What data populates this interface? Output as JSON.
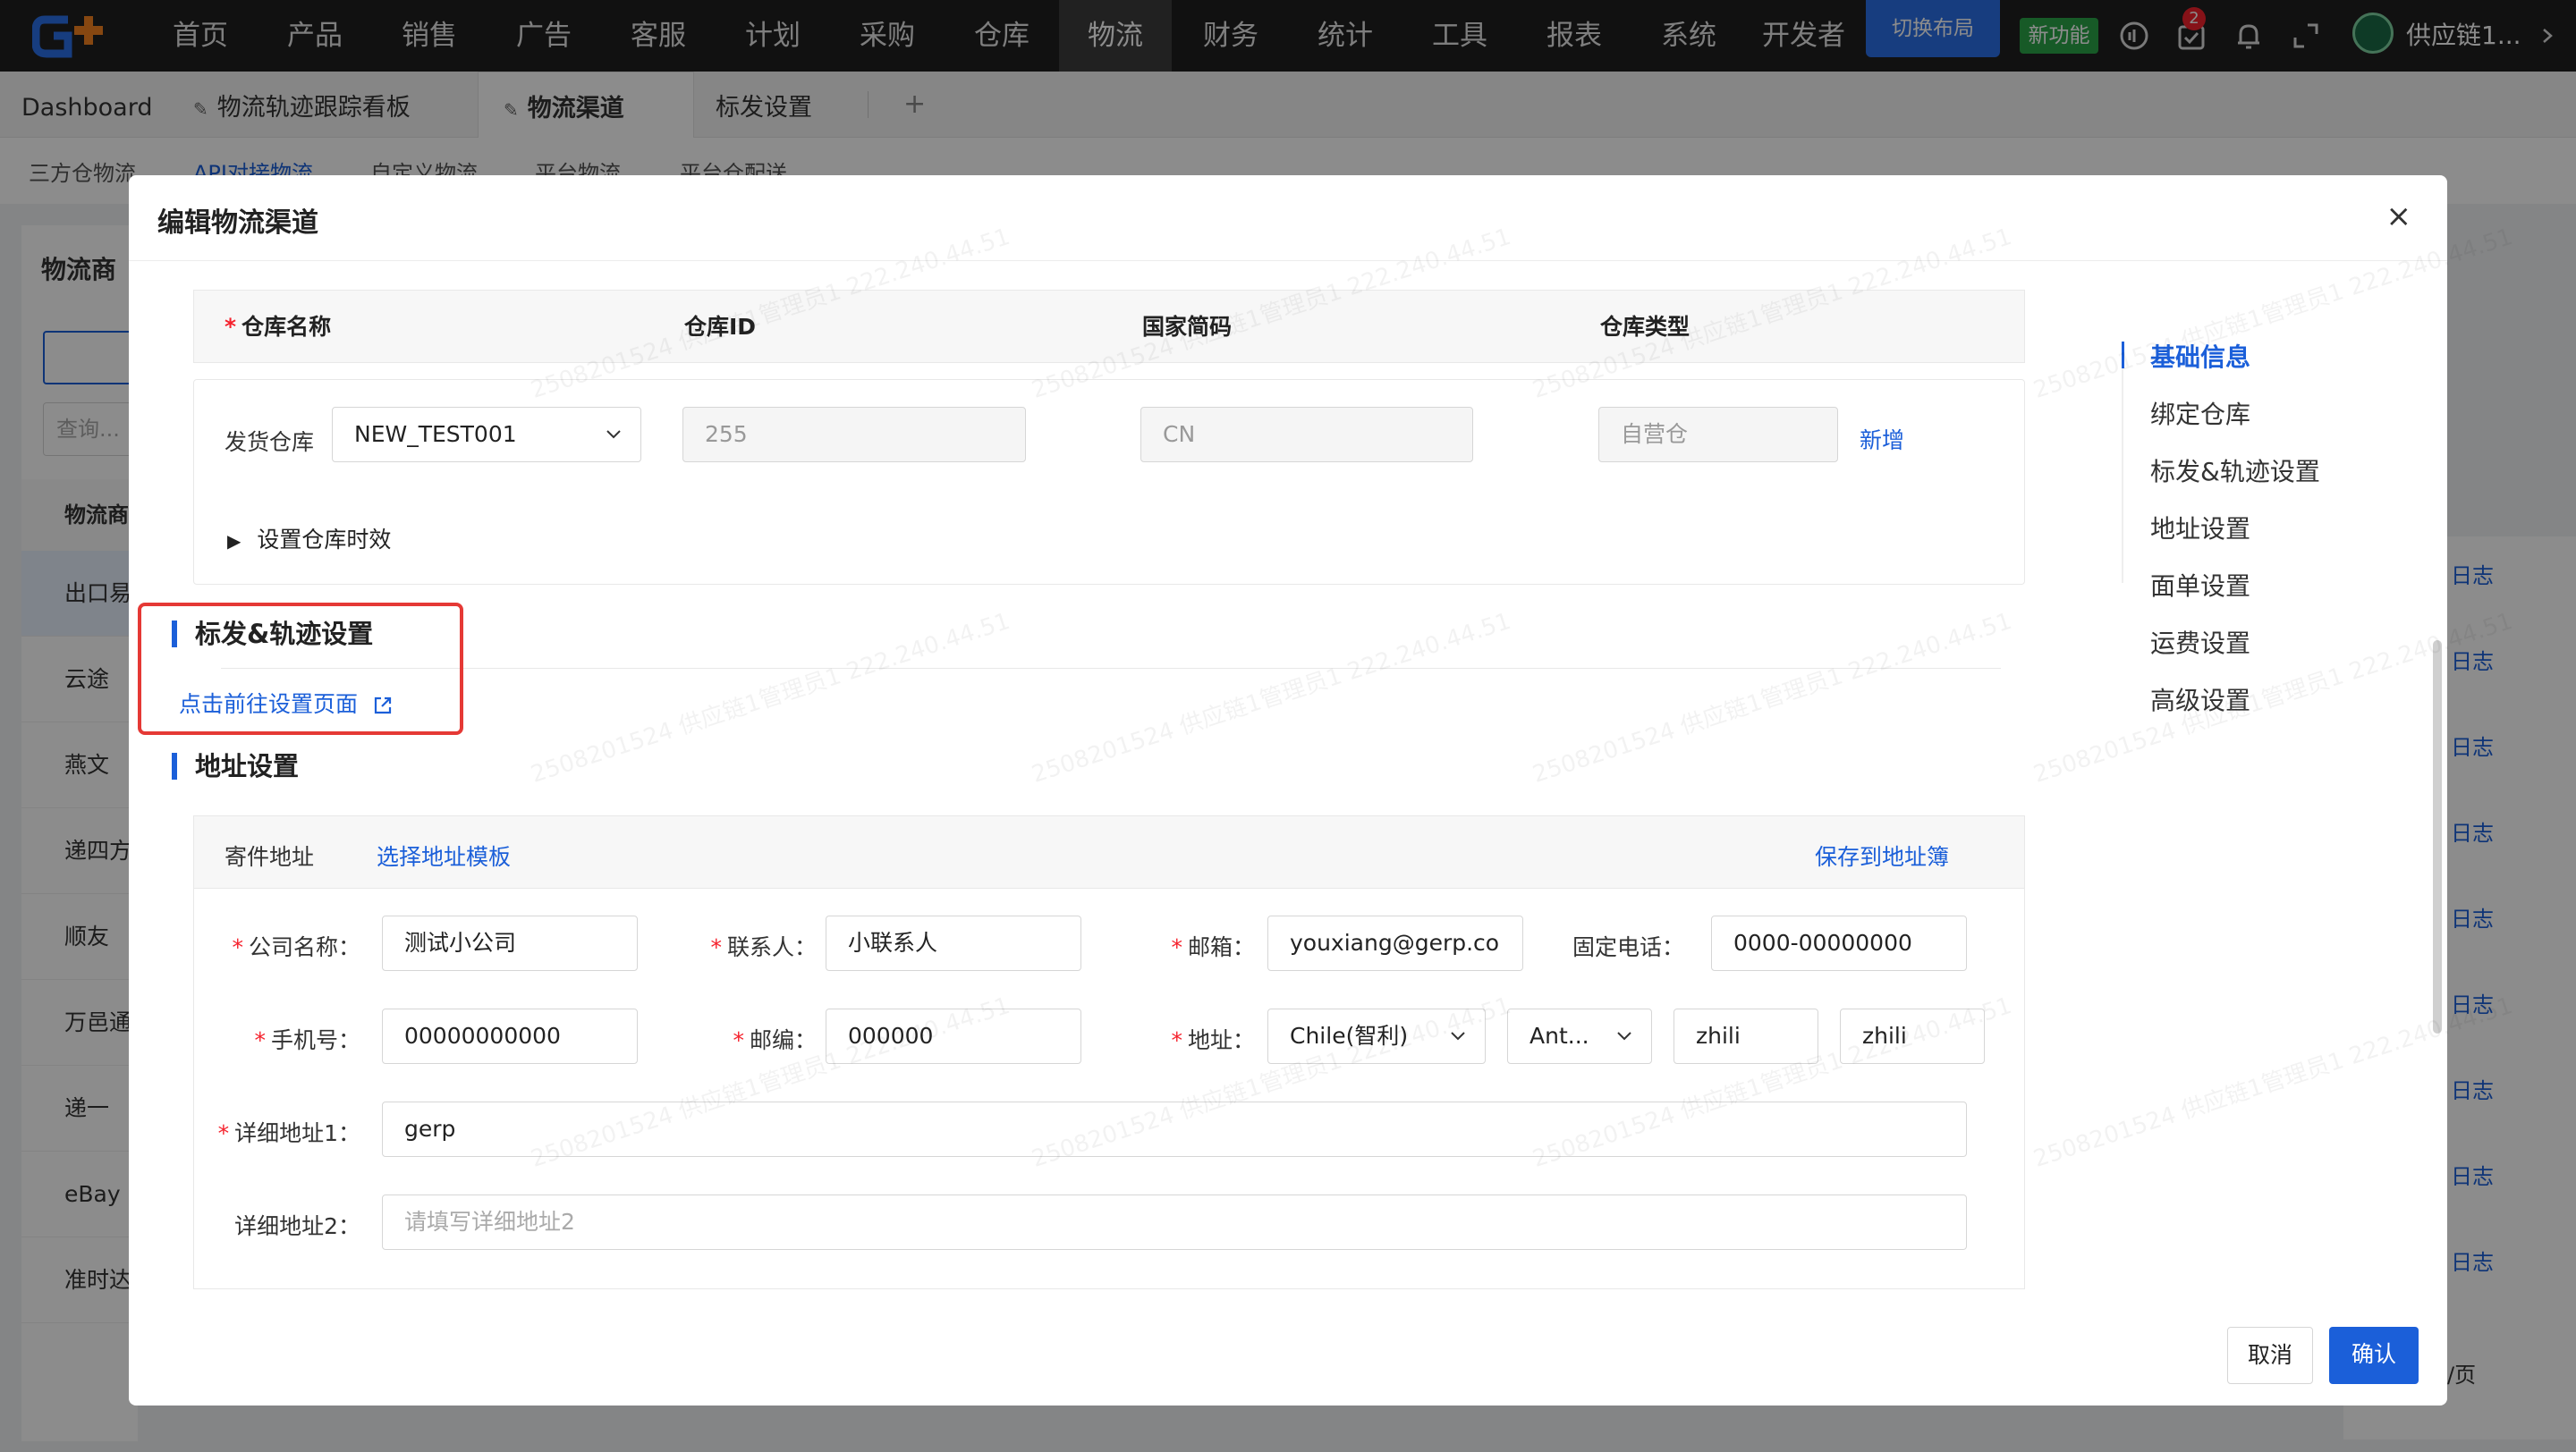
{
  "topnav": {
    "items": [
      "首页",
      "产品",
      "销售",
      "广告",
      "客服",
      "计划",
      "采购",
      "仓库",
      "物流",
      "财务",
      "统计",
      "工具",
      "报表",
      "系统",
      "开发者"
    ],
    "active": "物流",
    "switch_layout": "切换布局",
    "new_feature": "新功能",
    "notification_count": "2",
    "user_name": "供应链1..."
  },
  "tabs": {
    "dashboard": "Dashboard",
    "items": [
      "物流轨迹跟踪看板",
      "物流渠道",
      "标发设置"
    ],
    "active": "物流渠道",
    "add": "+"
  },
  "background": {
    "subtabs": [
      "三方仓物流",
      "API对接物流",
      "自定义物流",
      "平台物流",
      "平台仓配送"
    ],
    "active_subtab": "API对接物流",
    "left_title": "物流商",
    "search_placeholder": "查询...",
    "column_header": "物流商",
    "providers": [
      "出口易",
      "云途",
      "燕文",
      "递四方",
      "顺友",
      "万邑通",
      "递一",
      "eBay",
      "准时达"
    ],
    "log_label": "日志",
    "pagination": "/页"
  },
  "modal": {
    "title": "编辑物流渠道",
    "close": "×",
    "warehouse": {
      "headers": {
        "name": "仓库名称",
        "id": "仓库ID",
        "country": "国家简码",
        "type": "仓库类型"
      },
      "row_label": "发货仓库",
      "name_value": "NEW_TEST001",
      "id_value": "255",
      "country_value": "CN",
      "type_value": "自营仓",
      "add_link": "新增",
      "expand_label": "设置仓库时效"
    },
    "tracking_section": {
      "title": "标发&轨迹设置",
      "link": "点击前往设置页面"
    },
    "address_section": {
      "title": "地址设置",
      "header_label": "寄件地址",
      "choose_template": "选择地址模板",
      "save_to_book": "保存到地址簿",
      "company_label": "公司名称：",
      "company_value": "测试小公司",
      "contact_label": "联系人：",
      "contact_value": "小联系人",
      "email_label": "邮箱：",
      "email_value": "youxiang@gerp.co",
      "phone_label": "固定电话：",
      "phone_value": "0000-00000000",
      "mobile_label": "手机号：",
      "mobile_value": "00000000000",
      "zip_label": "邮编：",
      "zip_value": "000000",
      "address_label": "地址：",
      "country_select": "Chile(智利)",
      "region_select": "Ant...",
      "city_value": "zhili",
      "district_value": "zhili",
      "detail1_label": "详细地址1：",
      "detail1_value": "gerp",
      "detail2_label": "详细地址2：",
      "detail2_placeholder": "请填写详细地址2"
    },
    "sidenav": [
      "基础信息",
      "绑定仓库",
      "标发&轨迹设置",
      "地址设置",
      "面单设置",
      "运费设置",
      "高级设置"
    ],
    "sidenav_active": "基础信息",
    "cancel": "取消",
    "confirm": "确认"
  },
  "watermark": "2508201524 供应链1管理员1 222.240.44.51"
}
